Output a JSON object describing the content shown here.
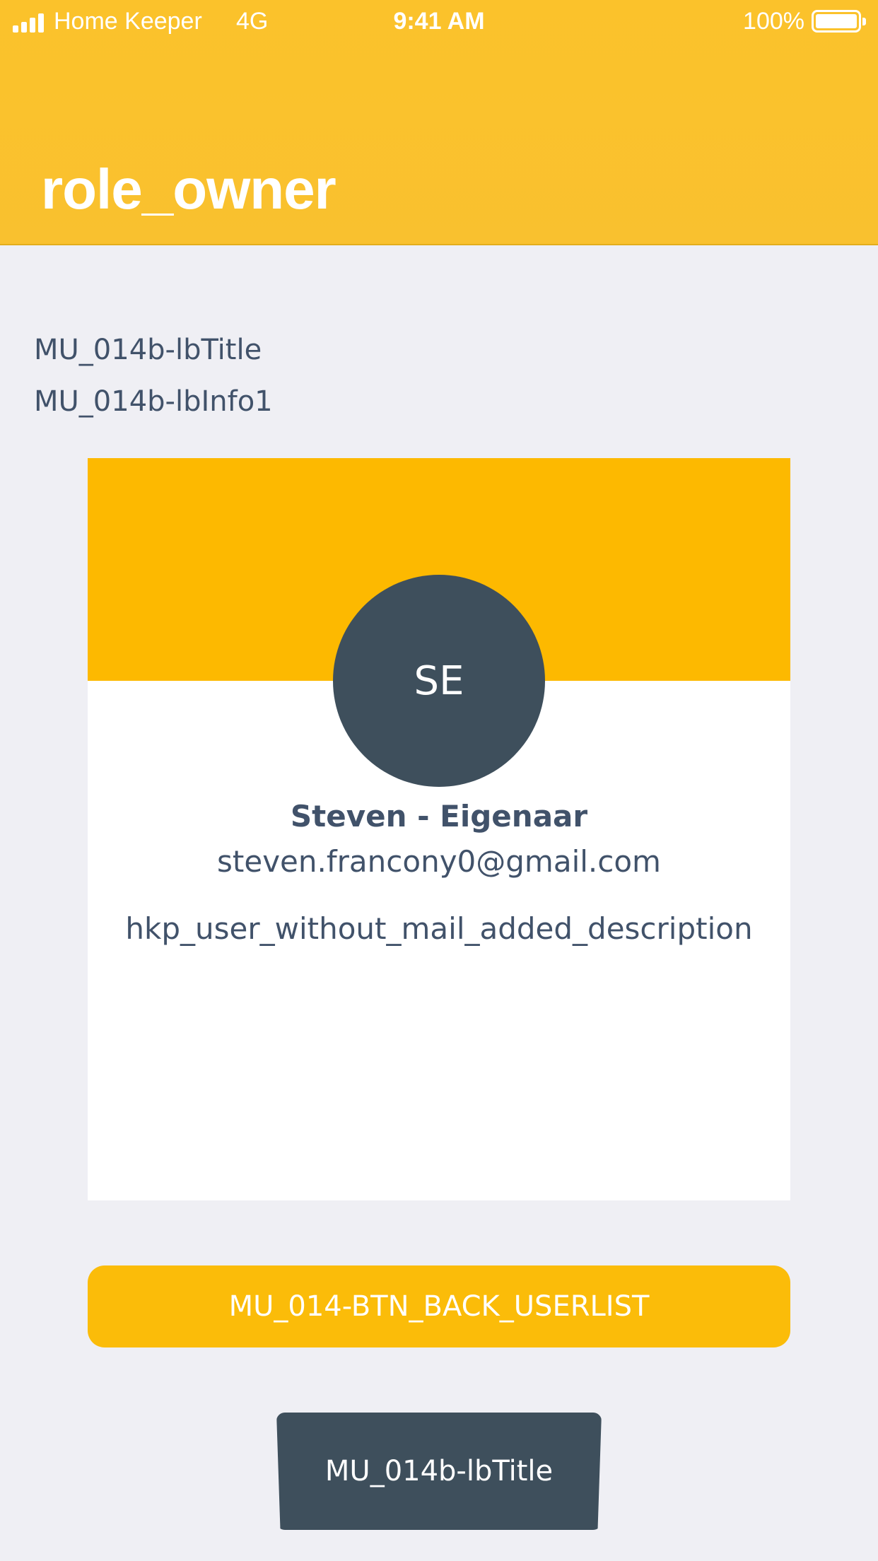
{
  "status_bar": {
    "carrier": "Home Keeper",
    "network": "4G",
    "time": "9:41 AM",
    "battery_percent": "100%",
    "battery_level": 1.0
  },
  "header": {
    "title": "role_owner"
  },
  "main": {
    "lb_title": "MU_014b-lbTitle",
    "lb_info1": "MU_014b-lbInfo1"
  },
  "user_card": {
    "initials": "SE",
    "name": "Steven - Eigenaar",
    "email": "steven.francony0@gmail.com",
    "description": "hkp_user_without_mail_added_description"
  },
  "buttons": {
    "back_userlist": "MU_014-BTN_BACK_USERLIST",
    "bottom_button": "MU_014b-lbTitle"
  },
  "colors": {
    "header_yellow": "#fbc22b",
    "banner_yellow": "#fdb900",
    "button_yellow": "#fbbc09",
    "dark_slate": "#3e4f5c",
    "text": "#41526a",
    "background": "#efeff4"
  }
}
